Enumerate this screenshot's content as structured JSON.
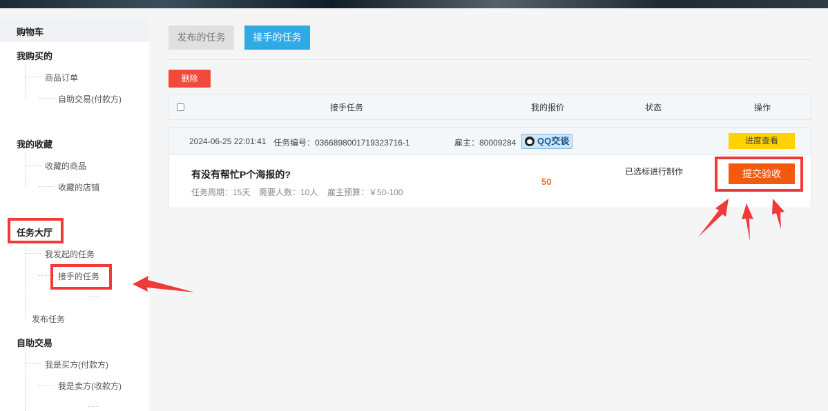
{
  "sidebar": {
    "cart": "购物车",
    "bought": {
      "head": "我购买的",
      "items": [
        "商品订单",
        "自助交易(付款方)"
      ]
    },
    "favorites": {
      "head": "我的收藏",
      "items": [
        "收藏的商品",
        "收藏的店铺"
      ]
    },
    "hall": {
      "head": "任务大厅",
      "items": [
        "我发起的任务",
        "接手的任务"
      ],
      "publish": "发布任务"
    },
    "self_trade": {
      "head": "自助交易",
      "items": [
        "我是买方(付款方)",
        "我是卖方(收款方)"
      ]
    }
  },
  "tabs": {
    "published": "发布的任务",
    "accepted": "接手的任务"
  },
  "delete_label": "删除",
  "table": {
    "headers": [
      "接手任务",
      "我的报价",
      "状态",
      "操作"
    ]
  },
  "order": {
    "datetime": "2024-06-25 22:01:41",
    "task_no": "任务编号：0366898001719323716-1",
    "employer": "雇主：80009284",
    "qq_label": "QQ交谈",
    "progress_label": "进度查看",
    "title": "有没有帮忙P个海报的?",
    "period": "任务周期：15天",
    "people": "需要人数：10人",
    "budget": "雇主预算：￥50-100",
    "price": "50",
    "status": "已选标进行制作",
    "submit_label": "提交验收"
  },
  "colors": {
    "accent": "#2eaae4",
    "danger": "#f04b3a",
    "submit": "#f35a10",
    "highlight": "#f03a3a"
  }
}
